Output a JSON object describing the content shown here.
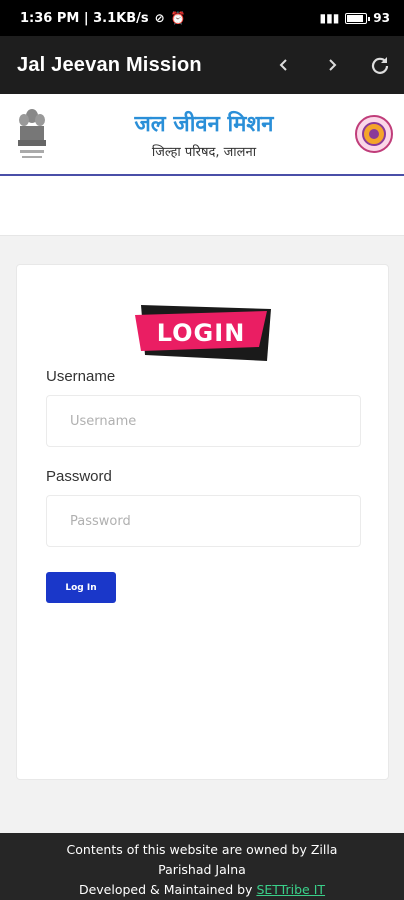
{
  "status_bar": {
    "time_speed": "1:36 PM | 3.1KB/s",
    "battery": "93"
  },
  "app_bar": {
    "title": "Jal Jeevan Mission",
    "back_icon": "chevron-left-icon",
    "forward_icon": "chevron-right-icon",
    "reload_icon": "reload-icon"
  },
  "header": {
    "title": "जल जीवन मिशन",
    "subtitle": "जिल्हा परिषद, जालना",
    "emblem_icon": "state-emblem-icon",
    "seal_icon": "zilla-parishad-seal-icon"
  },
  "login": {
    "banner_text": "LOGIN",
    "username_label": "Username",
    "username_placeholder": "Username",
    "password_label": "Password",
    "password_placeholder": "Password",
    "button_label": "Log In"
  },
  "footer": {
    "line1": "Contents of this website are owned by Zilla",
    "line2": "Parishad Jalna",
    "line3_prefix": "Developed & Maintained by ",
    "link_text": "SETTribe IT"
  },
  "colors": {
    "accent_blue": "#1a37c9",
    "banner_pink": "#ea1e63",
    "header_title_blue": "#2a8fd8",
    "footer_link": "#3ad08a"
  }
}
